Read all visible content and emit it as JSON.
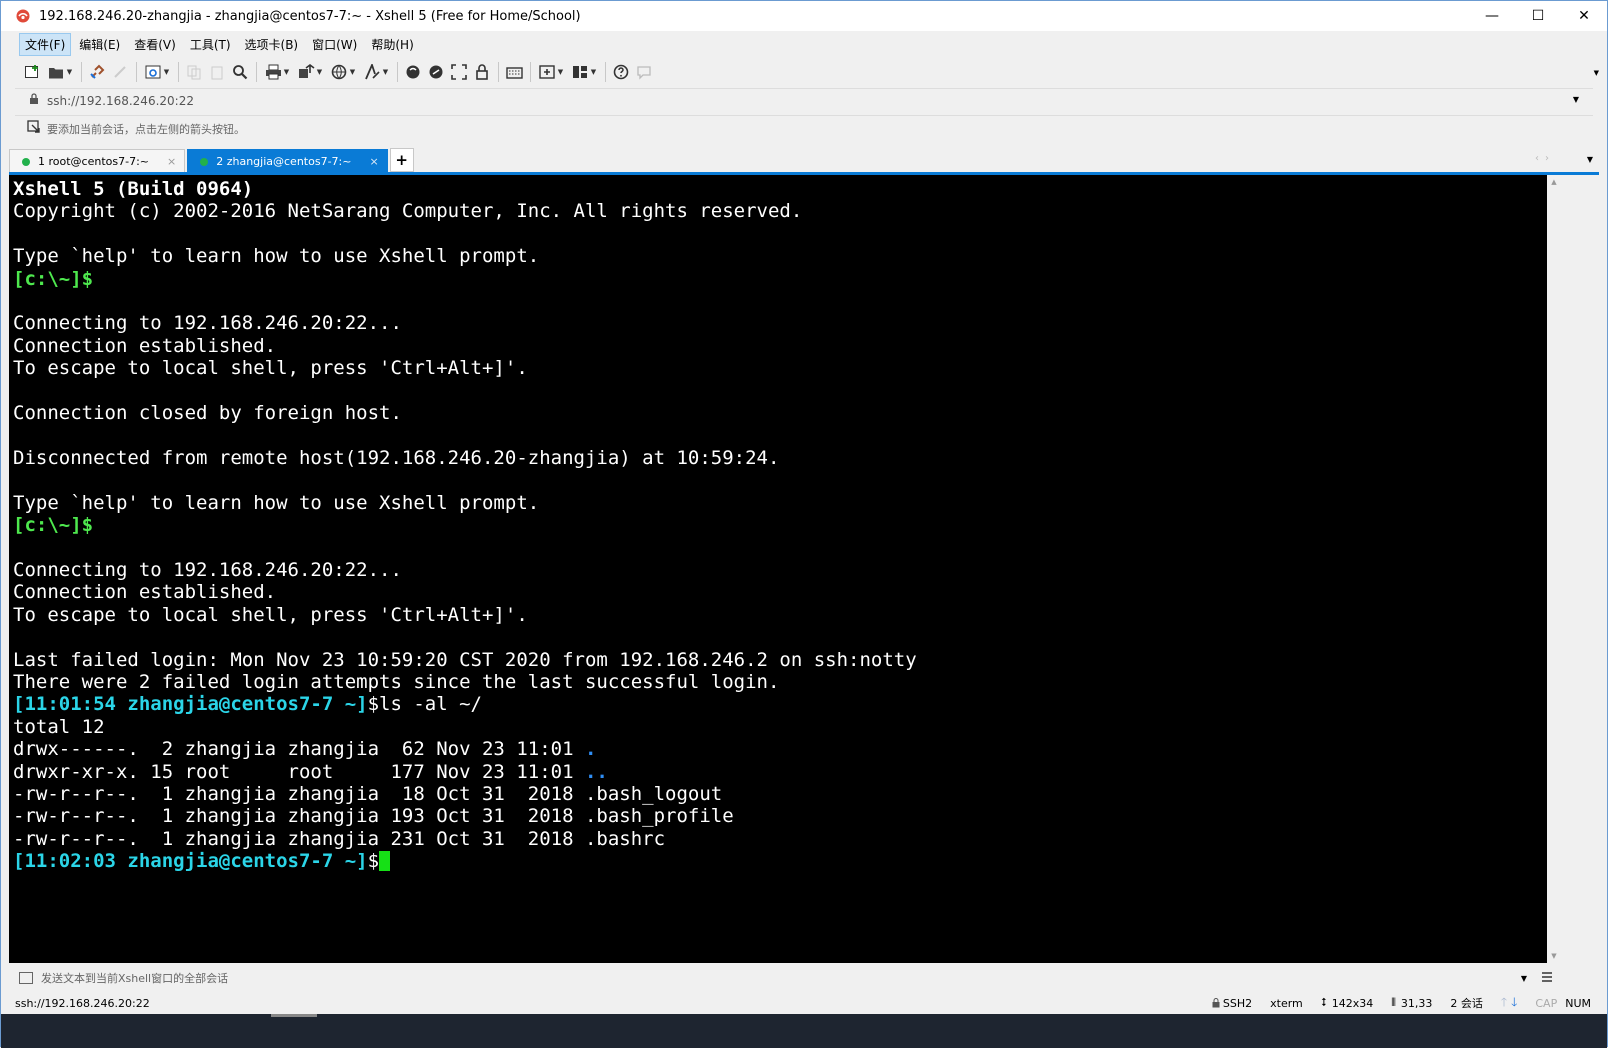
{
  "window": {
    "title": "192.168.246.20-zhangjia - zhangjia@centos7-7:~ - Xshell 5 (Free for Home/School)",
    "minimize": "—",
    "maximize": "☐",
    "close": "✕"
  },
  "menu": [
    "文件(F)",
    "编辑(E)",
    "查看(V)",
    "工具(T)",
    "选项卡(B)",
    "窗口(W)",
    "帮助(H)"
  ],
  "address": {
    "value": "ssh://192.168.246.20:22"
  },
  "hint": "要添加当前会话，点击左侧的箭头按钮。",
  "tabs": [
    {
      "label": "1 root@centos7-7:~",
      "active": false
    },
    {
      "label": "2 zhangjia@centos7-7:~",
      "active": true
    }
  ],
  "tab_add": "+",
  "terminal": {
    "banner_title": "Xshell 5 (Build 0964)",
    "banner_copyright": "Copyright (c) 2002-2016 NetSarang Computer, Inc. All rights reserved.",
    "help": "Type `help' to learn how to use Xshell prompt.",
    "local_prompt": "[c:\\~]$",
    "connecting": "Connecting to 192.168.246.20:22...",
    "established": "Connection established.",
    "escape": "To escape to local shell, press 'Ctrl+Alt+]'.",
    "closed": "Connection closed by foreign host.",
    "disconnected": "Disconnected from remote host(192.168.246.20-zhangjia) at 10:59:24.",
    "last_failed": "Last failed login: Mon Nov 23 10:59:20 CST 2020 from 192.168.246.2 on ssh:notty",
    "failed_attempts": "There were 2 failed login attempts since the last successful login.",
    "prompt1": "[11:01:54 zhangjia@centos7-7 ~]",
    "cmd1": "$ls -al ~/",
    "total": "total 12",
    "listing": [
      {
        "meta": "drwx------.  2 zhangjia zhangjia  62 Nov 23 11:01 ",
        "name": ".",
        "dir": true
      },
      {
        "meta": "drwxr-xr-x. 15 root     root     177 Nov 23 11:01 ",
        "name": "..",
        "dir": true
      },
      {
        "meta": "-rw-r--r--.  1 zhangjia zhangjia  18 Oct 31  2018 ",
        "name": ".bash_logout",
        "dir": false
      },
      {
        "meta": "-rw-r--r--.  1 zhangjia zhangjia 193 Oct 31  2018 ",
        "name": ".bash_profile",
        "dir": false
      },
      {
        "meta": "-rw-r--r--.  1 zhangjia zhangjia 231 Oct 31  2018 ",
        "name": ".bashrc",
        "dir": false
      }
    ],
    "prompt2": "[11:02:03 zhangjia@centos7-7 ~]",
    "cmd2": "$"
  },
  "compose": {
    "text": "发送文本到当前Xshell窗口的全部会话"
  },
  "status": {
    "left": "ssh://192.168.246.20:22",
    "protocol": "SSH2",
    "term": "xterm",
    "size": "142x34",
    "cursor_pos": "31,33",
    "sessions": "2 会话",
    "cap": "CAP",
    "num": "NUM"
  },
  "colors": {
    "accent": "#0a7bd6",
    "prompt_green": "#4ee84e",
    "prompt_cyan": "#2bd5e8",
    "dir_blue": "#2f8ef5",
    "cursor": "#16e016"
  }
}
